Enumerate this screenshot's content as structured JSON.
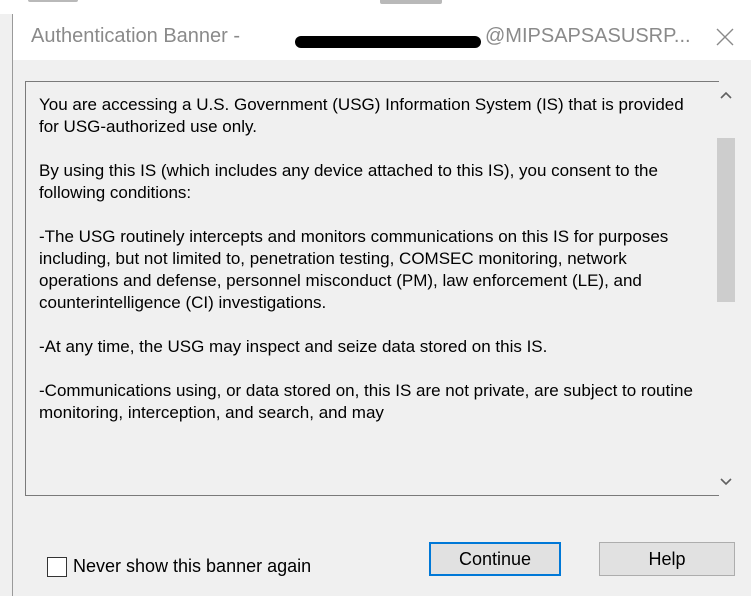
{
  "dialog": {
    "title_prefix": "Authentication Banner -",
    "title_suffix": "@MIPSAPSASUSRP...",
    "close_icon": "close-icon"
  },
  "banner": {
    "paragraphs": [
      "You are accessing a U.S. Government (USG) Information System (IS) that is provided for USG-authorized use only.",
      "By using this IS (which includes any device attached to this IS), you consent to the following conditions:",
      "-The USG routinely intercepts and monitors communications on this IS for purposes including, but not limited to, penetration testing, COMSEC monitoring, network operations and defense, personnel misconduct (PM), law enforcement (LE), and counterintelligence (CI) investigations.",
      "-At any time, the USG may inspect and seize data stored on this IS.",
      "-Communications using, or data stored on, this IS are not private, are subject to routine monitoring, interception, and search, and may"
    ]
  },
  "scrollbar": {
    "up_icon": "chevron-up-icon",
    "down_icon": "chevron-down-icon"
  },
  "footer": {
    "checkbox_label": "Never show this banner again",
    "checkbox_checked": false,
    "continue_label": "Continue",
    "help_label": "Help",
    "focus_color": "#0078d7"
  }
}
